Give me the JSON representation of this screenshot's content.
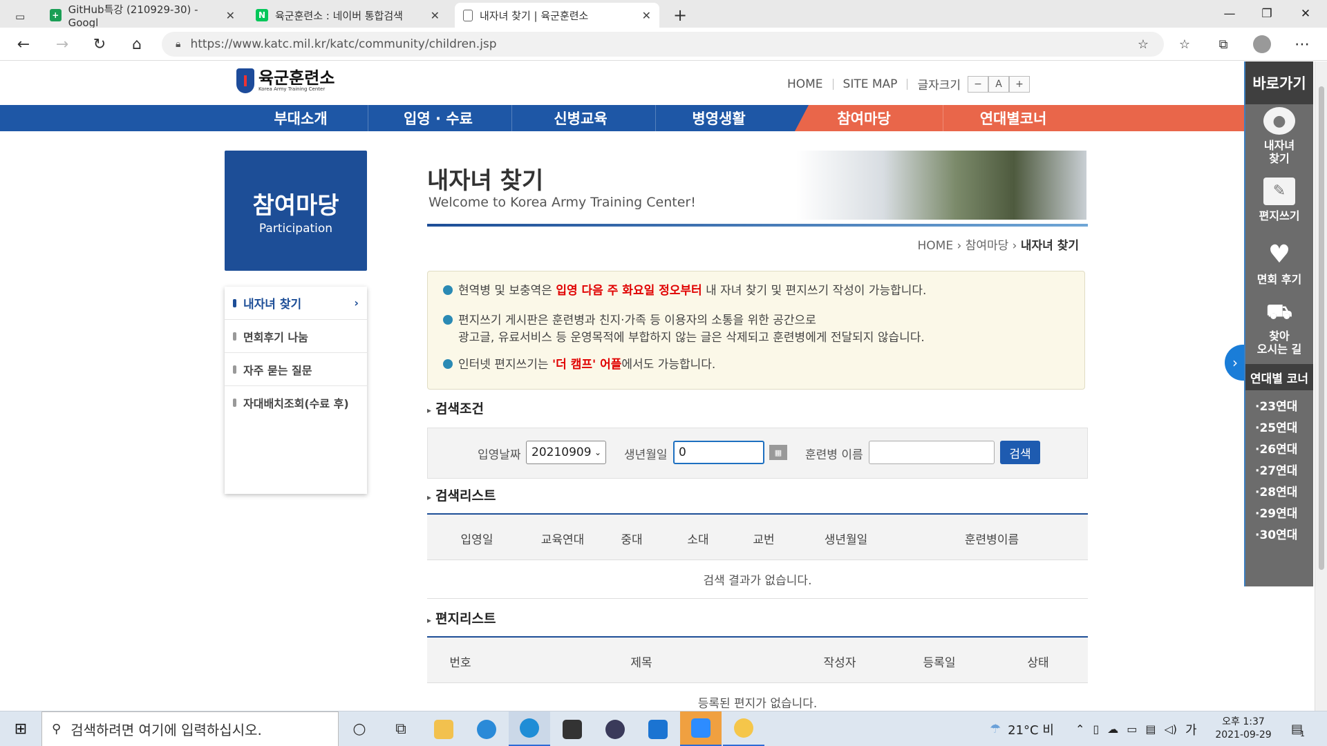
{
  "browser": {
    "tabs": [
      {
        "title": "GitHub특강 (210929-30) - Googl",
        "color": "#1a9e55",
        "glyph": "+"
      },
      {
        "title": "육군훈련소 : 네이버 통합검색",
        "color": "#03c75a",
        "glyph": "N"
      },
      {
        "title": "내자녀 찾기 | 육군훈련소",
        "color": "#ffffff",
        "glyph": ""
      }
    ],
    "url": "https://www.katc.mil.kr/katc/community/children.jsp"
  },
  "header": {
    "logo_kor": "육군훈련소",
    "logo_eng": "Korea Army Training Center",
    "links": [
      "HOME",
      "SITE MAP",
      "글자크기"
    ],
    "font_buttons": [
      "−",
      "A",
      "+"
    ]
  },
  "gnb": [
    "부대소개",
    "입영 · 수료",
    "신병교육",
    "병영생활",
    "참여마당",
    "연대별코너"
  ],
  "lnb": {
    "title_kor": "참여마당",
    "title_eng": "Participation",
    "items": [
      "내자녀 찾기",
      "면회후기 나눔",
      "자주 묻는 질문",
      "자대배치조회(수료 후)"
    ]
  },
  "page": {
    "title": "내자녀 찾기",
    "subtitle": "Welcome to Korea Army Training Center!",
    "breadcrumb": [
      "HOME",
      "참여마당",
      "내자녀 찾기"
    ]
  },
  "notice": {
    "n1_pre": "현역병 및 보충역은 ",
    "n1_red": "입영 다음 주 화요일 정오부터",
    "n1_post": " 내 자녀 찾기 및 편지쓰기 작성이 가능합니다.",
    "n2_line1": "편지쓰기 게시판은 훈련병과 친지·가족 등 이용자의 소통을 위한 공간으로",
    "n2_line2": "광고글, 유료서비스 등 운영목적에 부합하지 않는 글은 삭제되고 훈련병에게 전달되지 않습니다.",
    "n3_pre": "인터넷 편지쓰기는 ",
    "n3_red": "'더 캠프' 어플",
    "n3_post": "에서도 가능합니다."
  },
  "search": {
    "section_title": "검색조건",
    "date_label": "입영날짜",
    "date_value": "20210909",
    "birth_label": "생년월일",
    "birth_value": "0",
    "name_label": "훈련병 이름",
    "name_value": "",
    "button": "검색"
  },
  "results": {
    "section_title": "검색리스트",
    "columns": [
      "입영일",
      "교육연대",
      "중대",
      "소대",
      "교번",
      "생년월일",
      "훈련병이름"
    ],
    "empty": "검색 결과가 없습니다."
  },
  "letters": {
    "section_title": "편지리스트",
    "columns": [
      "번호",
      "제목",
      "작성자",
      "등록일",
      "상태"
    ],
    "empty": "등록된 편지가 없습니다."
  },
  "quickmenu": {
    "title": "바로가기",
    "items": [
      {
        "label": "내자녀\n찾기",
        "icon": "user-icon"
      },
      {
        "label": "편지쓰기",
        "icon": "letter-icon"
      },
      {
        "label": "면회 후기",
        "icon": "heart-icon"
      },
      {
        "label": "찾아\n오시는 길",
        "icon": "car-icon"
      }
    ],
    "regiment_title": "연대별 코너",
    "regiments": [
      "·23연대",
      "·25연대",
      "·26연대",
      "·27연대",
      "·28연대",
      "·29연대",
      "·30연대"
    ]
  },
  "taskbar": {
    "search_placeholder": "검색하려면 여기에 입력하십시오.",
    "weather": "21°C  비",
    "ime": "가",
    "time": "오후 1:37",
    "date": "2021-09-29",
    "notifications": "1"
  }
}
